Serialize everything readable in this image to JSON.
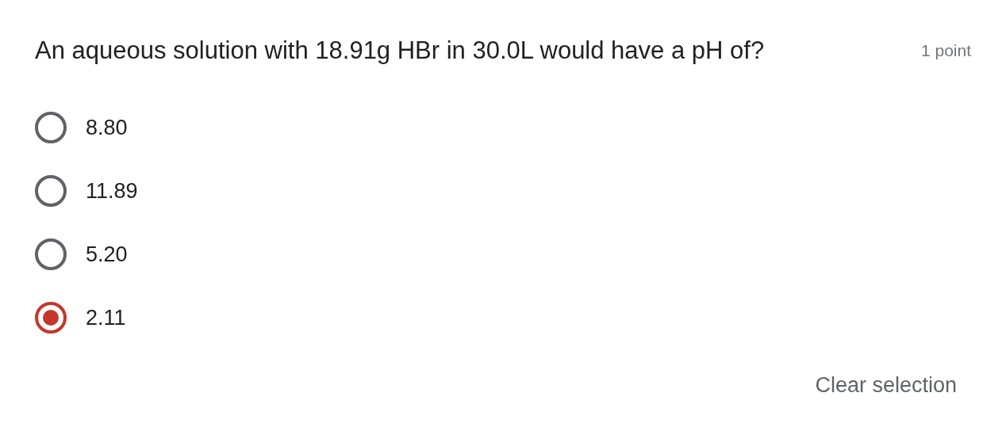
{
  "question": {
    "title": "An aqueous solution with 18.91g HBr in 30.0L would have a pH of?",
    "points": "1 point"
  },
  "options": [
    {
      "label": "8.80",
      "selected": false
    },
    {
      "label": "11.89",
      "selected": false
    },
    {
      "label": "5.20",
      "selected": false
    },
    {
      "label": "2.11",
      "selected": true
    }
  ],
  "clear_button": "Clear selection"
}
